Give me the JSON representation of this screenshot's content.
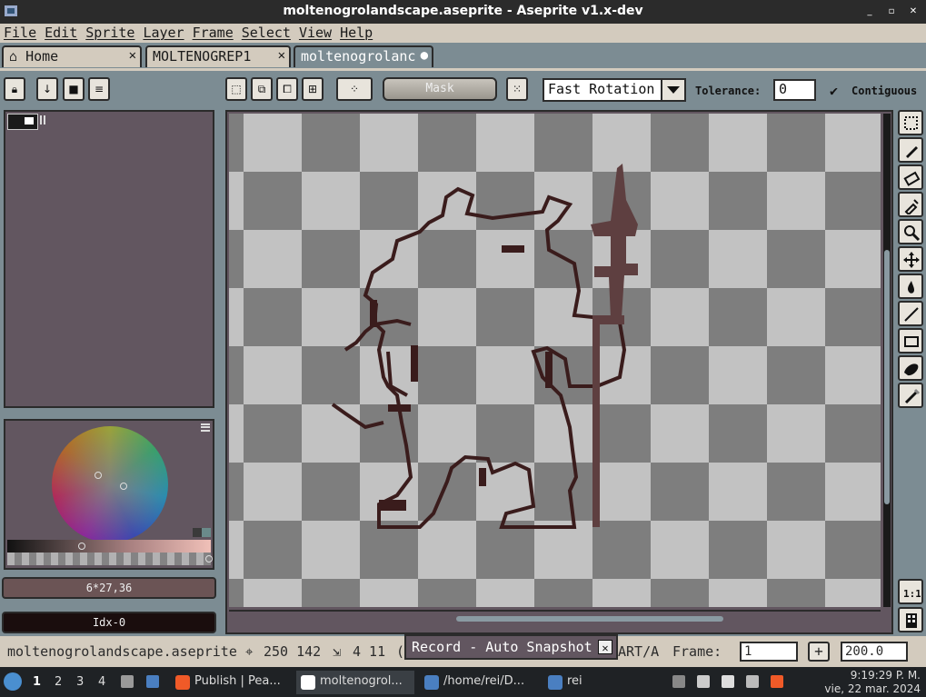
{
  "window": {
    "title": "moltenogrolandscape.aseprite - Aseprite v1.x-dev",
    "controls": [
      "_",
      "▫",
      "✕"
    ]
  },
  "menu": [
    "File",
    "Edit",
    "Sprite",
    "Layer",
    "Frame",
    "Select",
    "View",
    "Help"
  ],
  "tabs": [
    {
      "label": "Home",
      "close": "✕"
    },
    {
      "label": "MOLTENOGREP1",
      "close": "✕"
    },
    {
      "label": "moltenogrolanc",
      "close": "●"
    }
  ],
  "toolbar": {
    "mask_label": "Mask",
    "rotation_algorithm": "Fast Rotation",
    "tolerance_label": "Tolerance:",
    "tolerance_value": "0",
    "contiguous_label": "Contiguous",
    "contiguous_checked": true
  },
  "color_panel": {
    "fg_value": "6*27,36",
    "bg_value": "Idx-0",
    "fg_color": "#6b5455",
    "bg_color": "#1a0d0d"
  },
  "status": {
    "filename": "moltenogrolandscape.aseprite",
    "position": "250 142",
    "size": "4 11",
    "truncated": "(.",
    "mode": "ART/A",
    "frame_label": "Frame:",
    "frame_value": "1",
    "zoom_value": "200.0"
  },
  "record_popup": {
    "label": "Record - Auto Snapshot"
  },
  "taskbar": {
    "workspaces": [
      "1",
      "2",
      "3",
      "4"
    ],
    "tasks": [
      {
        "label": "Publish | Pea...",
        "color": "#f05a28"
      },
      {
        "label": "moltenogrol...",
        "color": "#ffffff"
      },
      {
        "label": "/home/rei/D...",
        "color": "#4a7fc1"
      },
      {
        "label": "rei",
        "color": "#4a7fc1"
      }
    ],
    "time": "9:19:29 P. M.",
    "date": "vie, 22 mar. 2024"
  }
}
